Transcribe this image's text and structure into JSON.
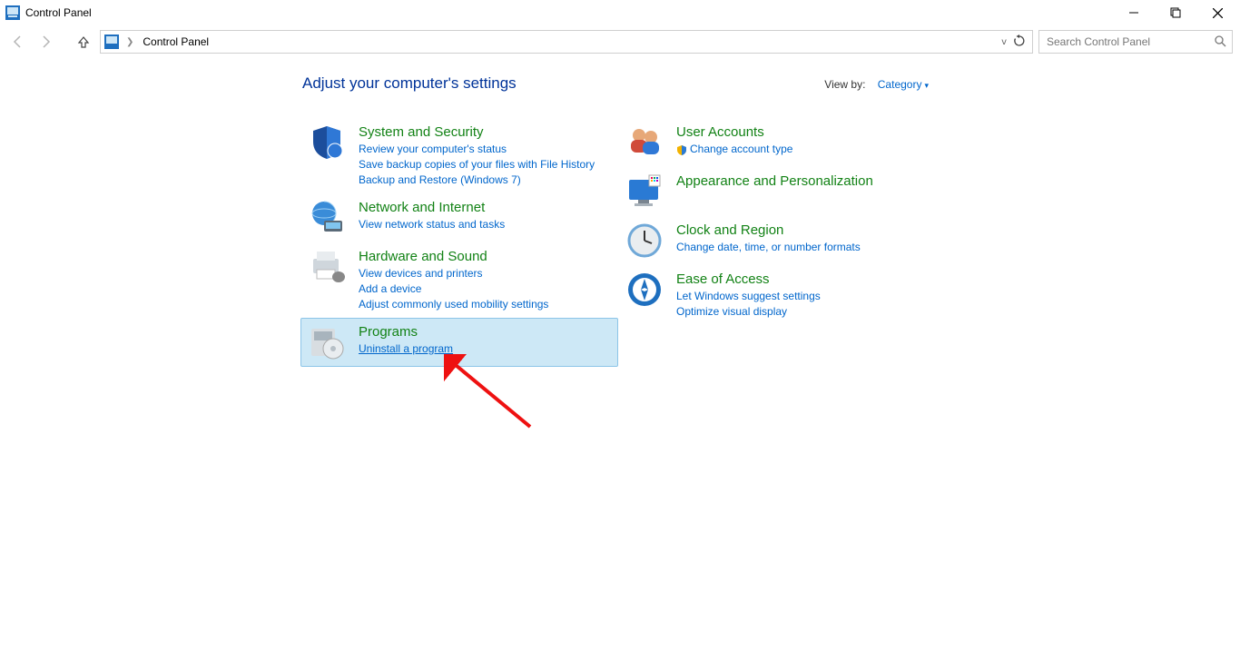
{
  "window": {
    "title": "Control Panel"
  },
  "toolbar": {
    "breadcrumb": "Control Panel",
    "search_placeholder": "Search Control Panel"
  },
  "page": {
    "heading": "Adjust your computer's settings",
    "viewby_label": "View by:",
    "viewby_value": "Category"
  },
  "cats": {
    "system": {
      "title": "System and Security",
      "l1": "Review your computer's status",
      "l2": "Save backup copies of your files with File History",
      "l3": "Backup and Restore (Windows 7)"
    },
    "network": {
      "title": "Network and Internet",
      "l1": "View network status and tasks"
    },
    "hardware": {
      "title": "Hardware and Sound",
      "l1": "View devices and printers",
      "l2": "Add a device",
      "l3": "Adjust commonly used mobility settings"
    },
    "programs": {
      "title": "Programs",
      "l1": "Uninstall a program"
    },
    "users": {
      "title": "User Accounts",
      "l1": "Change account type"
    },
    "appearance": {
      "title": "Appearance and Personalization"
    },
    "clock": {
      "title": "Clock and Region",
      "l1": "Change date, time, or number formats"
    },
    "ease": {
      "title": "Ease of Access",
      "l1": "Let Windows suggest settings",
      "l2": "Optimize visual display"
    }
  }
}
